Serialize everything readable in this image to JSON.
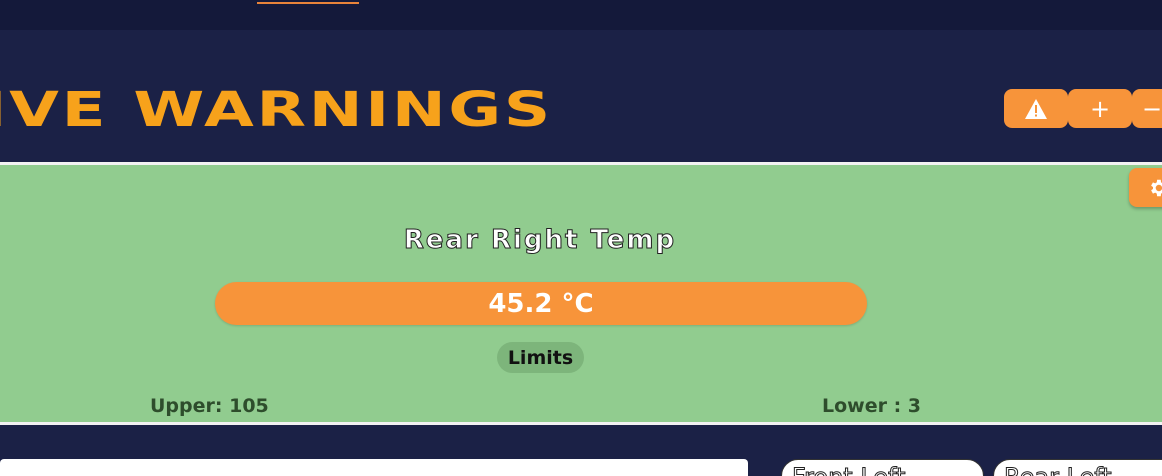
{
  "header": {
    "title": "TIVE WARNINGS",
    "buttons": {
      "warning_icon": "warning-triangle-icon",
      "plus_label": "+",
      "minus_label": "−"
    }
  },
  "panel": {
    "settings_icon": "gear-icon",
    "sensor_name": "Rear Right Temp",
    "value": "45.2 °C",
    "limits_label": "Limits",
    "upper_limit": "Upper: 105",
    "lower_limit": "Lower : 3"
  },
  "bottom_tabs": [
    "Front Left",
    "Rear Left"
  ],
  "colors": {
    "background": "#1b2146",
    "accent": "#f7943a",
    "title": "#f7a21b",
    "panel": "#91cc8f"
  }
}
